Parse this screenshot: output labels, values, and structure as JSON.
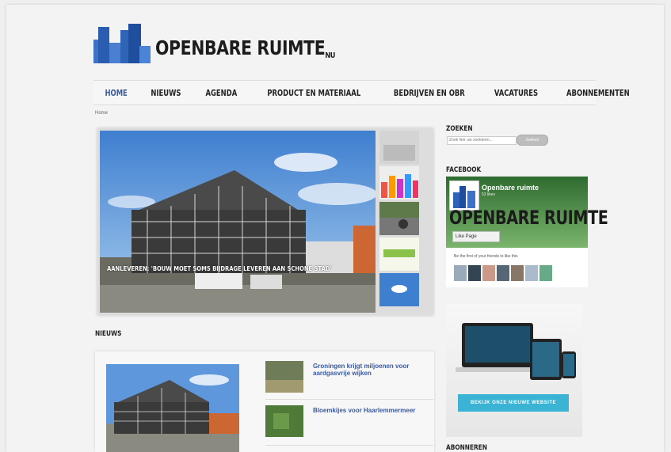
{
  "logo": {
    "text": "OPENBARE RUIMTE",
    "suffix": "NU"
  },
  "nav": {
    "items": [
      {
        "label": "HOME"
      },
      {
        "label": "NIEUWS"
      },
      {
        "label": "AGENDA"
      },
      {
        "label": "PRODUCT EN MATERIAAL"
      },
      {
        "label": "BEDRIJVEN EN OBR"
      },
      {
        "label": "VACATURES"
      },
      {
        "label": "ABONNEMENTEN"
      }
    ]
  },
  "breadcrumb": "Home",
  "slider": {
    "caption": "AANLEVEREN: 'BOUW MOET SOMS BIJDRAGE LEVEREN AAN SCHONE STAD'"
  },
  "news": {
    "heading": "NIEUWS",
    "items": [
      {
        "title": "Groningen krijgt miljoenen voor aardgasvrije wijken"
      },
      {
        "title": "Bloemkijes voor Haarlemmermeer"
      }
    ]
  },
  "sidebar": {
    "search_heading": "ZOEKEN",
    "search_placeholder": "Zoek hier uw zoekterm...",
    "search_button": "Zoeken",
    "facebook_heading": "FACEBOOK",
    "fb_page_name": "Openbare ruimte",
    "fb_likes": "53 likes",
    "fb_cover_text": "OPENBARE RUIMTE",
    "fb_like_button": "Like Page",
    "fb_cta": "Be the first of your friends to like this",
    "ad_cta": "BEKIJK ONZE NIEUWE WEBSITE",
    "bottom_heading": "ABONNEREN"
  },
  "colors": {
    "accent": "#3a5a96",
    "logo_blue": "#2e63b8",
    "cta": "#3ab3d4"
  }
}
